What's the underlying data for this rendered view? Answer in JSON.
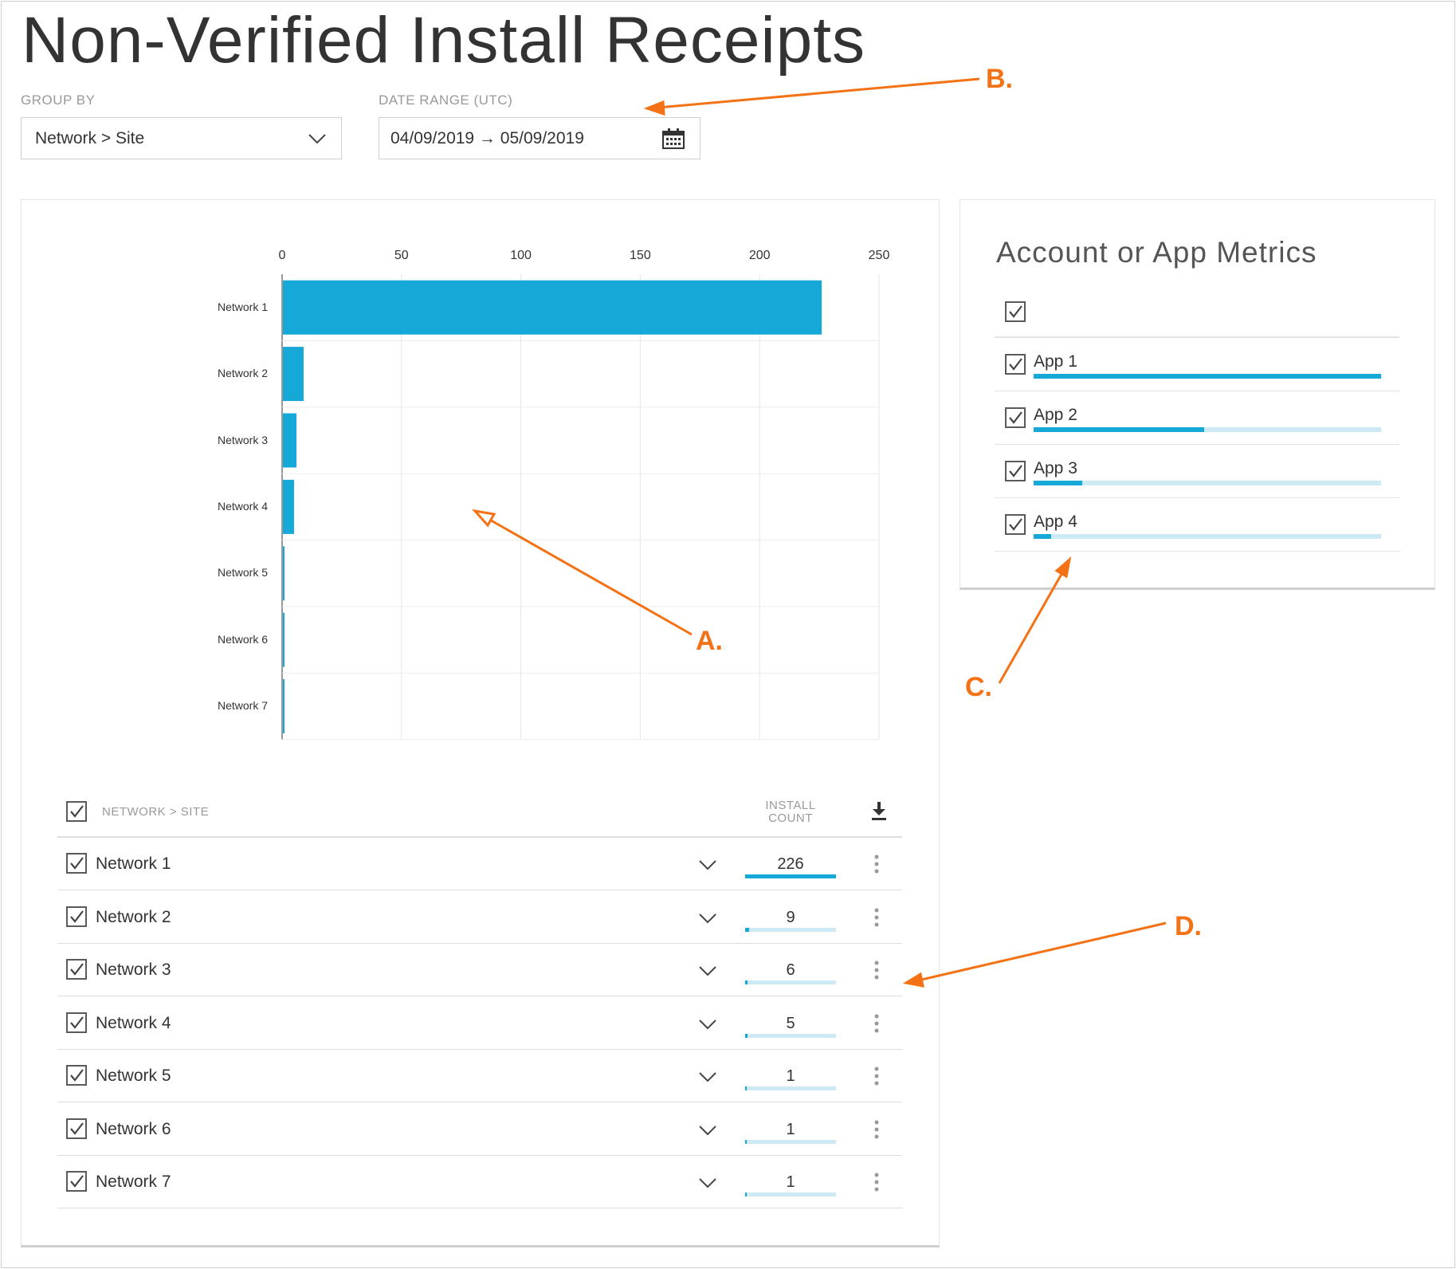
{
  "page": {
    "title": "Non-Verified Install Receipts"
  },
  "filters": {
    "group_by": {
      "label": "GROUP BY",
      "value": "Network > Site"
    },
    "date_range": {
      "label": "DATE RANGE (UTC)",
      "value": "04/09/2019 → 05/09/2019"
    }
  },
  "chart_data": {
    "type": "bar",
    "orientation": "horizontal",
    "categories": [
      "Network 1",
      "Network 2",
      "Network 3",
      "Network 4",
      "Network 5",
      "Network 6",
      "Network 7"
    ],
    "values": [
      226,
      9,
      6,
      5,
      1,
      1,
      1
    ],
    "xlim": [
      0,
      250
    ],
    "xticks": [
      0,
      50,
      100,
      150,
      200,
      250
    ],
    "x_axis_position": "top",
    "grid": true,
    "color": "#16a9d8"
  },
  "metrics": {
    "title": "Account or App Metrics",
    "apps": [
      {
        "label": "App 1",
        "fraction": 1.0
      },
      {
        "label": "App 2",
        "fraction": 0.49
      },
      {
        "label": "App 3",
        "fraction": 0.14
      },
      {
        "label": "App 4",
        "fraction": 0.05
      }
    ]
  },
  "table": {
    "col_name": "NETWORK > SITE",
    "col_count_line1": "INSTALL",
    "col_count_line2": "COUNT",
    "rows": [
      {
        "name": "Network 1",
        "count": "226",
        "fraction": 1.0
      },
      {
        "name": "Network 2",
        "count": "9",
        "fraction": 0.04
      },
      {
        "name": "Network 3",
        "count": "6",
        "fraction": 0.03
      },
      {
        "name": "Network 4",
        "count": "5",
        "fraction": 0.022
      },
      {
        "name": "Network 5",
        "count": "1",
        "fraction": 0.004
      },
      {
        "name": "Network 6",
        "count": "1",
        "fraction": 0.004
      },
      {
        "name": "Network 7",
        "count": "1",
        "fraction": 0.004
      }
    ]
  },
  "annotations": {
    "a": "A.",
    "b": "B.",
    "c": "C.",
    "d": "D."
  },
  "colors": {
    "accent": "#16a9d8",
    "accent_light": "#cde9f4",
    "annotation": "#f47216"
  }
}
